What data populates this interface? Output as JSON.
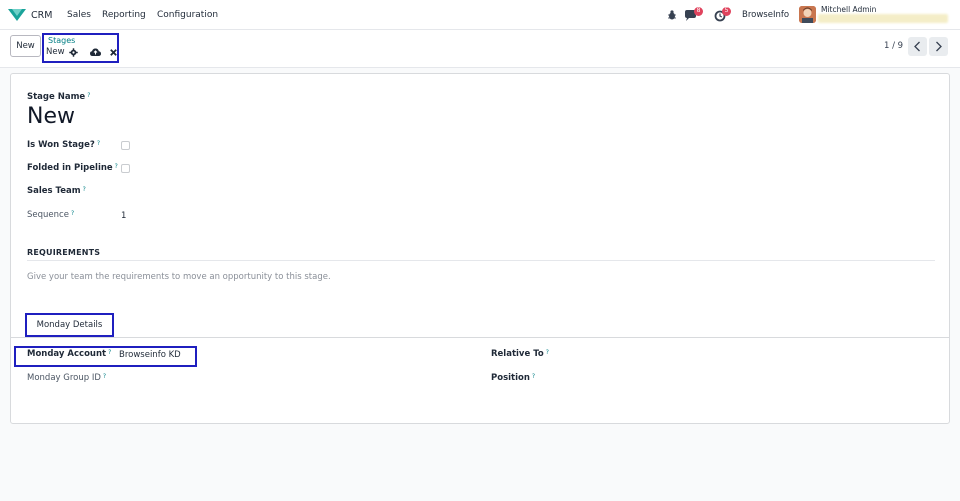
{
  "navbar": {
    "app_name": "CRM",
    "menu": [
      "Sales",
      "Reporting",
      "Configuration"
    ],
    "chat_badge": "8",
    "activity_badge": "5",
    "company": "BrowseInfo",
    "user": "Mitchell Admin"
  },
  "control_panel": {
    "new_button": "New",
    "breadcrumb_parent": "Stages",
    "breadcrumb_current": "New",
    "pager": "1 / 9"
  },
  "form": {
    "stage_name_label": "Stage Name",
    "stage_name_value": "New",
    "is_won_label": "Is Won Stage?",
    "folded_label": "Folded in Pipeline",
    "sales_team_label": "Sales Team",
    "sequence_label": "Sequence",
    "sequence_value": "1",
    "requirements_title": "REQUIREMENTS",
    "requirements_placeholder": "Give your team the requirements to move an opportunity to this stage.",
    "tab_label": "Monday Details",
    "monday_account_label": "Monday Account",
    "monday_account_value": "Browseinfo KD",
    "monday_group_label": "Monday Group ID",
    "relative_to_label": "Relative To",
    "position_label": "Position",
    "help_mark": "?"
  },
  "colors": {
    "accent": "#017e84",
    "highlight_box": "#1f1fbf",
    "badge": "#e0445e"
  }
}
